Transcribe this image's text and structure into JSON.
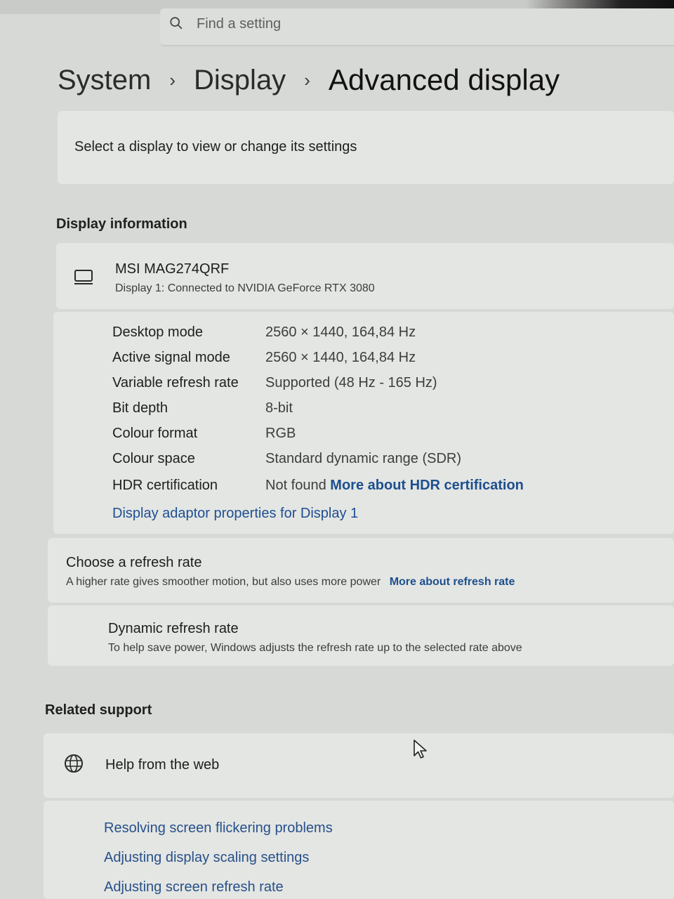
{
  "search": {
    "placeholder": "Find a setting"
  },
  "breadcrumb": {
    "level1": "System",
    "level2": "Display",
    "current": "Advanced display"
  },
  "select_display": {
    "text": "Select a display to view or change its settings"
  },
  "display_information": {
    "heading": "Display information",
    "monitor_name": "MSI MAG274QRF",
    "monitor_sub": "Display 1: Connected to NVIDIA GeForce RTX 3080",
    "rows": [
      {
        "label": "Desktop mode",
        "value": "2560 × 1440, 164,84 Hz"
      },
      {
        "label": "Active signal mode",
        "value": "2560 × 1440, 164,84 Hz"
      },
      {
        "label": "Variable refresh rate",
        "value": "Supported (48 Hz - 165 Hz)"
      },
      {
        "label": "Bit depth",
        "value": "8-bit"
      },
      {
        "label": "Colour format",
        "value": "RGB"
      },
      {
        "label": "Colour space",
        "value": "Standard dynamic range (SDR)"
      },
      {
        "label": "HDR certification",
        "value": "Not found",
        "link": "More about HDR certification"
      }
    ],
    "adapter_link": "Display adaptor properties for Display 1"
  },
  "refresh": {
    "title": "Choose a refresh rate",
    "subtitle": "A higher rate gives smoother motion, but also uses more power",
    "link": "More about refresh rate",
    "dynamic_title": "Dynamic refresh rate",
    "dynamic_subtitle": "To help save power, Windows adjusts the refresh rate up to the selected rate above"
  },
  "related_support": {
    "heading": "Related support",
    "help_title": "Help from the web",
    "links": [
      "Resolving screen flickering problems",
      "Adjusting display scaling settings",
      "Adjusting screen refresh rate"
    ]
  },
  "icons": {
    "search": "search-icon",
    "monitor": "monitor-icon",
    "globe": "globe-icon",
    "cursor": "mouse-cursor-icon"
  }
}
